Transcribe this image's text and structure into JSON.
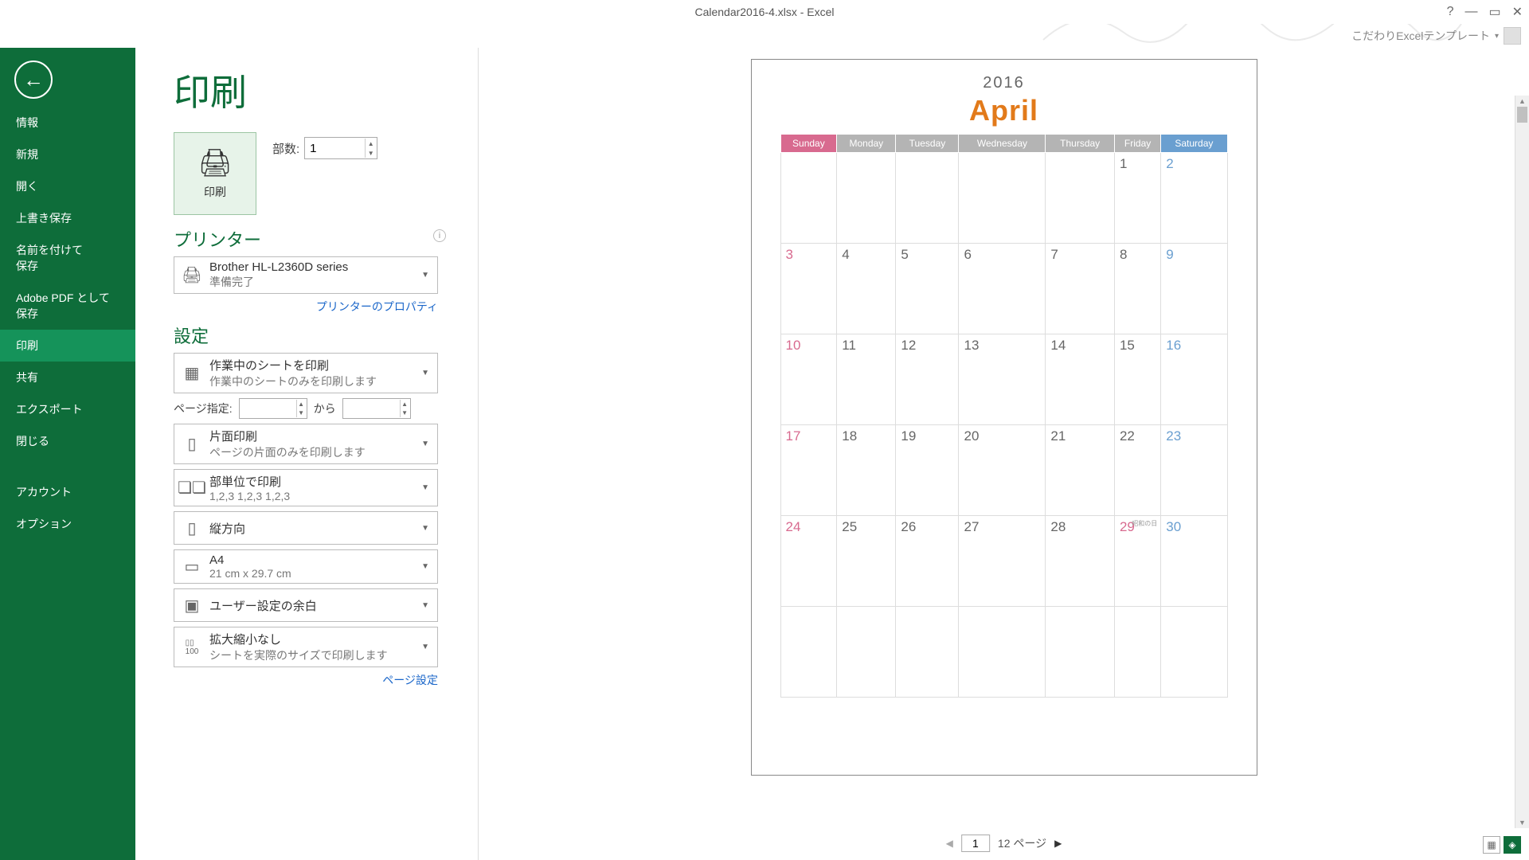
{
  "window_title": "Calendar2016-4.xlsx - Excel",
  "user_label": "こだわりExcelテンプレート",
  "page_title": "印刷",
  "nav": [
    "情報",
    "新規",
    "開く",
    "上書き保存",
    "名前を付けて\n保存",
    "Adobe PDF として\n保存",
    "印刷",
    "共有",
    "エクスポート",
    "閉じる",
    "アカウント",
    "オプション"
  ],
  "print_label": "印刷",
  "copies_label": "部数:",
  "copies_value": "1",
  "printer_heading": "プリンター",
  "printer_name": "Brother HL-L2360D series",
  "printer_status": "準備完了",
  "printer_props": "プリンターのプロパティ",
  "settings_heading": "設定",
  "s1_t": "作業中のシートを印刷",
  "s1_s": "作業中のシートのみを印刷します",
  "range_label": "ページ指定:",
  "range_to": "から",
  "s2_t": "片面印刷",
  "s2_s": "ページの片面のみを印刷します",
  "s3_t": "部単位で印刷",
  "s3_s": "1,2,3    1,2,3    1,2,3",
  "s4_t": "縦方向",
  "s5_t": "A4",
  "s5_s": "21 cm x 29.7 cm",
  "s6_t": "ユーザー設定の余白",
  "s7_t": "拡大縮小なし",
  "s7_s": "シートを実際のサイズで印刷します",
  "page_setup": "ページ設定",
  "cal_year": "2016",
  "cal_month": "April",
  "days": [
    "Sunday",
    "Monday",
    "Tuesday",
    "Wednesday",
    "Thursday",
    "Friday",
    "Saturday"
  ],
  "weeks": [
    [
      "",
      "",
      "",
      "",
      "",
      "1",
      "2"
    ],
    [
      "3",
      "4",
      "5",
      "6",
      "7",
      "8",
      "9"
    ],
    [
      "10",
      "11",
      "12",
      "13",
      "14",
      "15",
      "16"
    ],
    [
      "17",
      "18",
      "19",
      "20",
      "21",
      "22",
      "23"
    ],
    [
      "24",
      "25",
      "26",
      "27",
      "28",
      "29",
      "30"
    ]
  ],
  "holiday_txt": "昭和の日",
  "pager_cur": "1",
  "pager_total": "12 ページ"
}
